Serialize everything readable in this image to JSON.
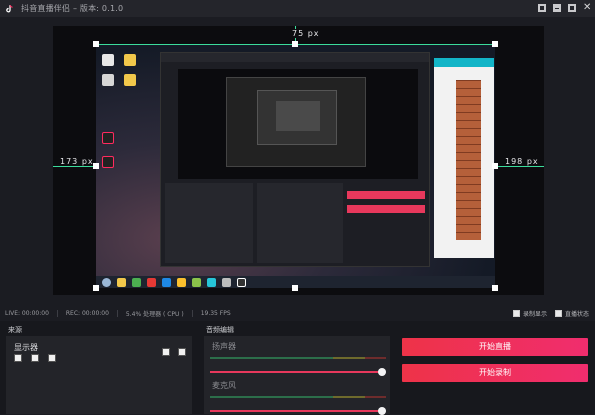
{
  "window": {
    "title": "抖音直播伴侣 – 版本: 0.1.0"
  },
  "preview": {
    "dim_top": "75 px",
    "dim_left": "173 px",
    "dim_right": "198 px"
  },
  "status": {
    "live": "LIVE: 00:00:00",
    "rec": "REC: 00:00:00",
    "cpu": "5.4% 处理器 ( CPU )",
    "fps": "19.35 FPS",
    "option_1": "录制显示",
    "option_2": "直播状态"
  },
  "sources": {
    "header": "来源",
    "items": [
      {
        "label": "显示器"
      }
    ]
  },
  "audio": {
    "header": "音频编辑",
    "channels": [
      {
        "label": "扬声器",
        "level": 0.98
      },
      {
        "label": "麦克风",
        "level": 0.98
      }
    ]
  },
  "actions": {
    "start_live": "开始直播",
    "start_record": "开始录制"
  },
  "colors": {
    "accent": "#ee3348",
    "guide": "#3bdc9c",
    "background": "#1b1c22"
  }
}
